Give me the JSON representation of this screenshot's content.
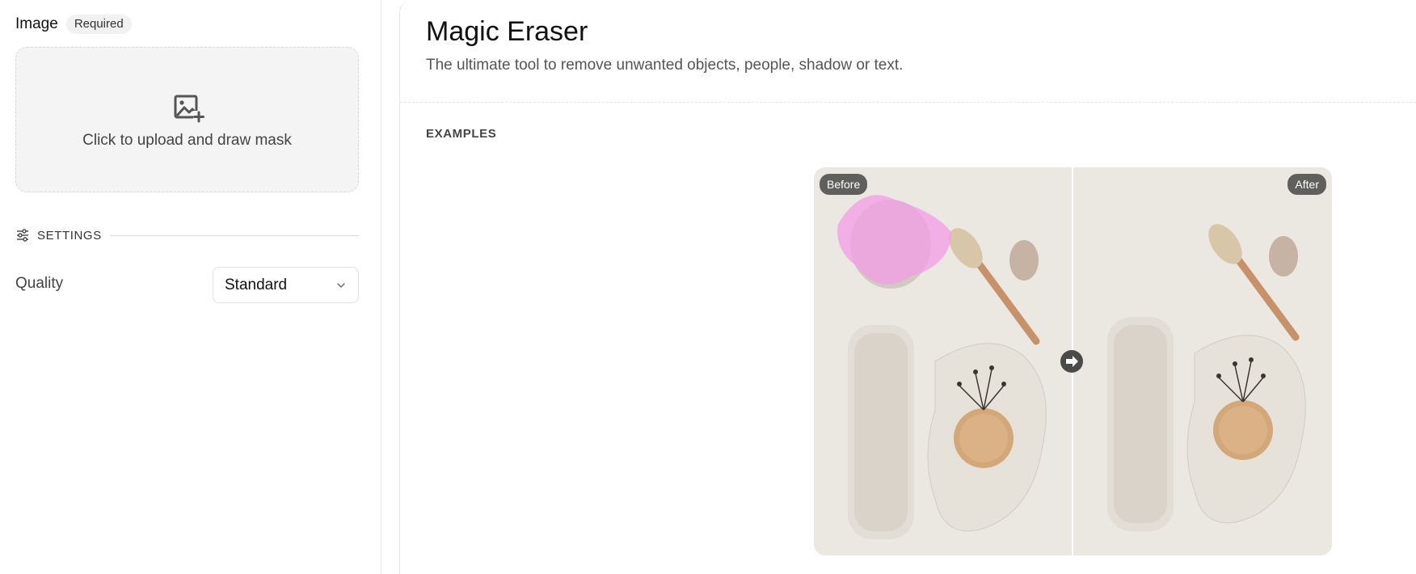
{
  "sidebar": {
    "image_label": "Image",
    "required_badge": "Required",
    "upload_text": "Click to upload and draw mask",
    "settings_label": "SETTINGS",
    "quality_label": "Quality",
    "quality_value": "Standard"
  },
  "main": {
    "title": "Magic Eraser",
    "subtitle": "The ultimate tool to remove unwanted objects, people, shadow or text.",
    "examples_label": "EXAMPLES",
    "before_label": "Before",
    "after_label": "After"
  },
  "colors": {
    "mask_highlight": "#f39ce6",
    "background_photo": "#ece9e4"
  }
}
